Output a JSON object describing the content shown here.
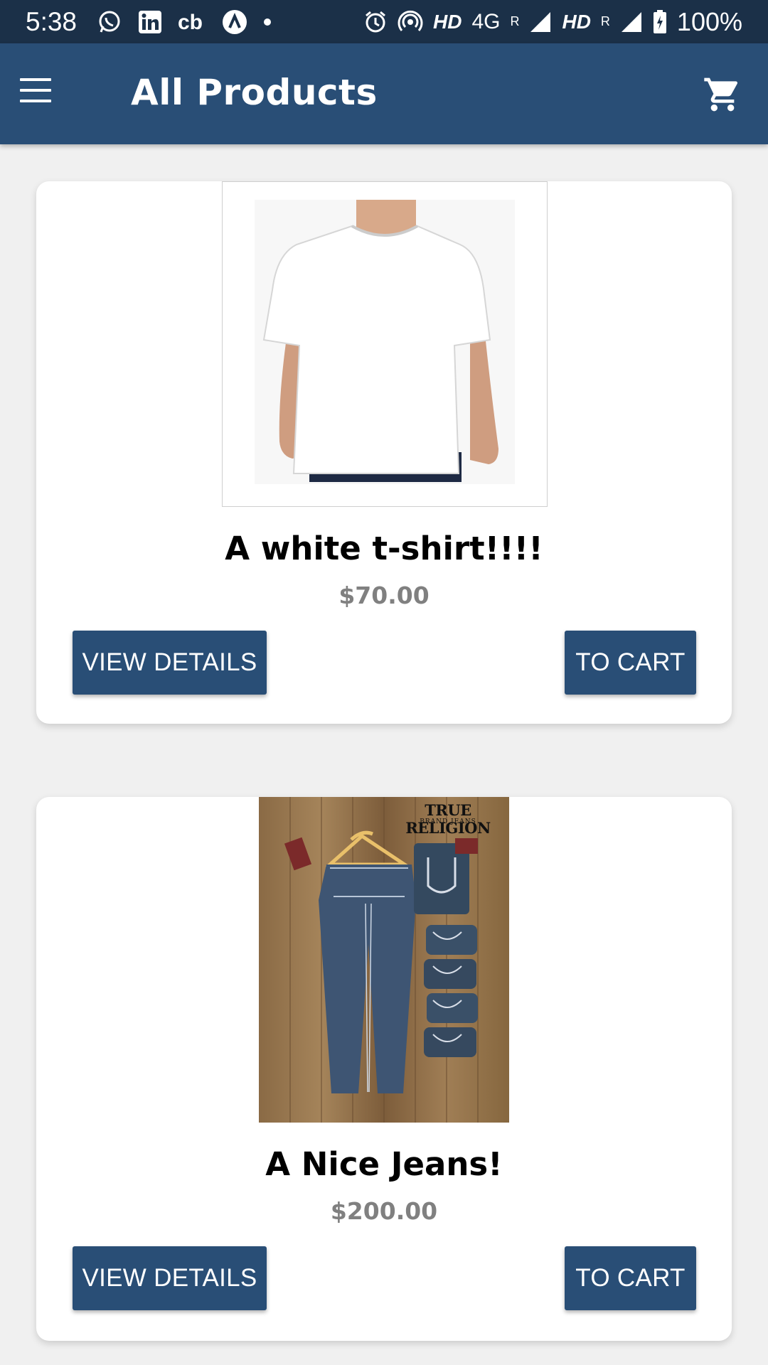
{
  "status_bar": {
    "time": "5:38",
    "network_1": "HD",
    "network_type": "4G",
    "roaming_1": "R",
    "network_2": "HD",
    "roaming_2": "R",
    "battery": "100%"
  },
  "app_bar": {
    "title": "All Products",
    "menu_icon": "menu-icon",
    "cart_icon": "cart-icon"
  },
  "products": [
    {
      "name": "A white t-shirt!!!!",
      "price": "$70.00",
      "image": "white-tshirt-photo",
      "view_details_label": "VIEW DETAILS",
      "to_cart_label": "TO CART"
    },
    {
      "name": "A Nice Jeans!",
      "price": "$200.00",
      "image": "jeans-photo",
      "image_brand_text": "TRUE RELIGION",
      "image_brand_subtext": "BRAND JEANS",
      "view_details_label": "VIEW DETAILS",
      "to_cart_label": "TO CART"
    }
  ],
  "colors": {
    "status_bar": "#1b3048",
    "app_bar": "#294e76",
    "button": "#294e76",
    "background": "#f0f0f0",
    "price": "#808080"
  }
}
